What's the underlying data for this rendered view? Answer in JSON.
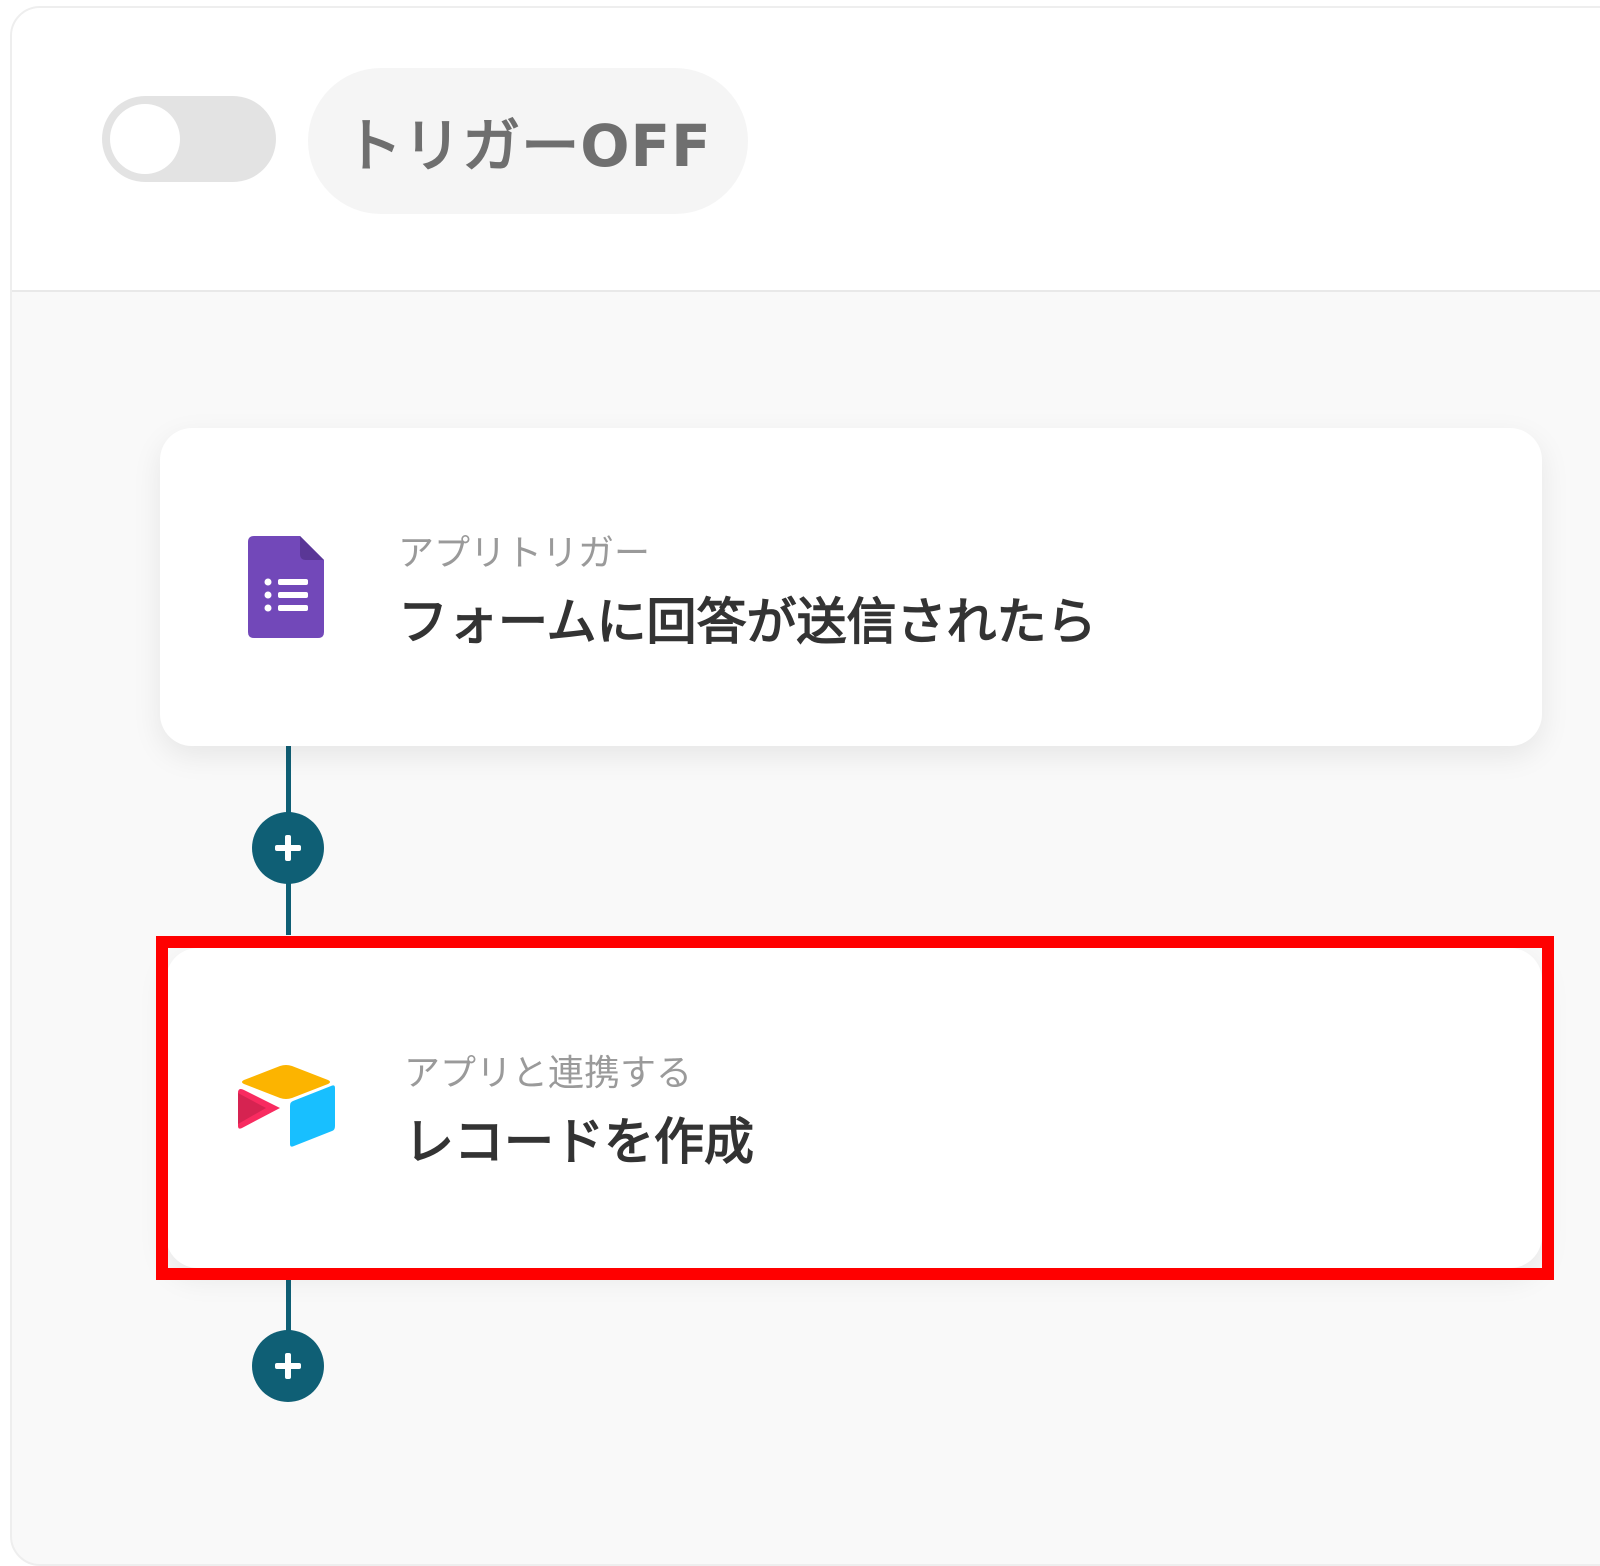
{
  "header": {
    "trigger_status_label": "トリガーOFF",
    "trigger_enabled": false
  },
  "flow": {
    "steps": [
      {
        "category": "アプリトリガー",
        "title": "フォームに回答が送信されたら",
        "app_icon": "google-forms-icon"
      },
      {
        "category": "アプリと連携する",
        "title": "レコードを作成",
        "app_icon": "airtable-icon"
      }
    ],
    "add_button_icon": "plus-icon"
  },
  "colors": {
    "connector": "#0f5f75",
    "highlight": "#ff0000",
    "forms_purple": "#7248b9"
  }
}
